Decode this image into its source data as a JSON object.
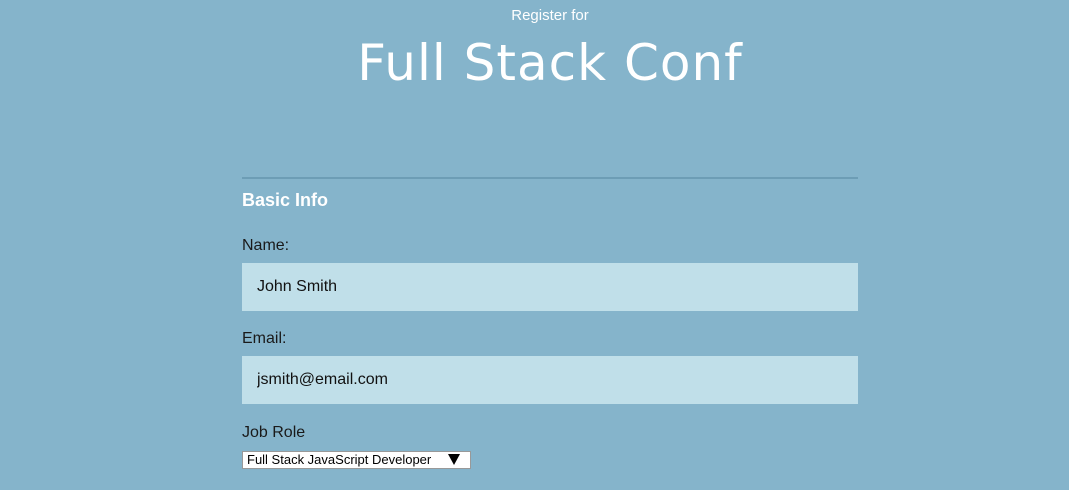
{
  "header": {
    "subtitle": "Register for",
    "title": "Full Stack Conf"
  },
  "form": {
    "section_title": "Basic Info",
    "name": {
      "label": "Name:",
      "value": "John Smith"
    },
    "email": {
      "label": "Email:",
      "value": "jsmith@email.com"
    },
    "job_role": {
      "label": "Job Role",
      "selected": "Full Stack JavaScript Developer"
    }
  },
  "colors": {
    "background": "#85b4cb",
    "input_background": "#c0dfe9",
    "divider": "#6d9db5"
  },
  "icons": {
    "select_arrow": "triangle-down-icon"
  }
}
